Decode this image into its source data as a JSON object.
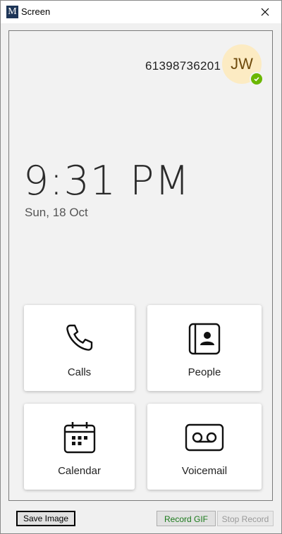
{
  "window": {
    "title": "Screen"
  },
  "status": {
    "phone_number": "61398736201",
    "avatar_initials": "JW",
    "presence": "available"
  },
  "clock": {
    "time": "9:31 PM",
    "date": "Sun, 18 Oct"
  },
  "tiles": [
    {
      "label": "Calls",
      "icon": "phone-icon"
    },
    {
      "label": "People",
      "icon": "contact-book-icon"
    },
    {
      "label": "Calendar",
      "icon": "calendar-icon"
    },
    {
      "label": "Voicemail",
      "icon": "voicemail-icon"
    }
  ],
  "toolbar": {
    "save_label": "Save Image",
    "record_gif_label": "Record GIF",
    "stop_record_label": "Stop Record"
  },
  "colors": {
    "presence_green": "#6bb700",
    "avatar_bg": "#fcebc3",
    "record_gif_text": "#1b7a1b"
  }
}
